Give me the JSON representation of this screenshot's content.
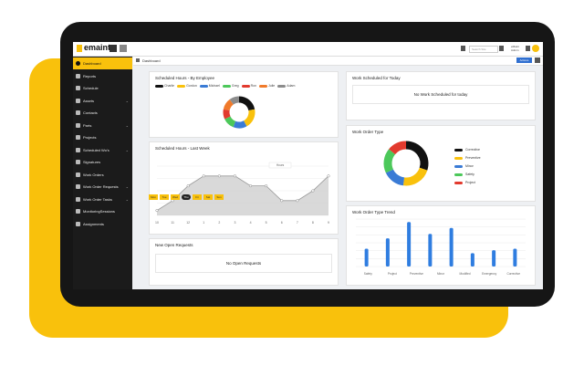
{
  "colors": {
    "accent": "#F9C10C",
    "tablet": "#161616",
    "sidebar": "#1b1b1b",
    "bar": "#2f7de0",
    "link_button": "#2f6fd0"
  },
  "topbar": {
    "logo_text": "emaint",
    "search_placeholder": "Search Site",
    "user_lines": [
      "eMaint",
      "Admin"
    ]
  },
  "sidebar": {
    "items": [
      {
        "label": "Dashboard",
        "icon": "dashboard-icon",
        "active": true,
        "caret": false
      },
      {
        "label": "Reports",
        "icon": "reports-icon",
        "caret": false
      },
      {
        "label": "Schedule",
        "icon": "calendar-icon",
        "caret": false
      },
      {
        "label": "Assets",
        "icon": "assets-icon",
        "caret": true
      },
      {
        "label": "Contacts",
        "icon": "contacts-icon",
        "caret": false
      },
      {
        "label": "Parts",
        "icon": "parts-icon",
        "caret": true
      },
      {
        "label": "Projects",
        "icon": "projects-icon",
        "caret": false
      },
      {
        "label": "Scheduled Wo's",
        "icon": "scheduled-icon",
        "caret": true
      },
      {
        "label": "Signatures",
        "icon": "signature-icon",
        "caret": false
      },
      {
        "label": "Work Orders",
        "icon": "wrench-icon",
        "caret": false
      },
      {
        "label": "Work Order Requests",
        "icon": "request-icon",
        "caret": true
      },
      {
        "label": "Work Order Tasks",
        "icon": "tasks-icon",
        "caret": true
      },
      {
        "label": "MonitoringSessions",
        "icon": "monitor-icon",
        "caret": false
      },
      {
        "label": "Assignments",
        "icon": "assignments-icon",
        "caret": false
      }
    ]
  },
  "breadcrumb": {
    "label": "Dashboard",
    "button_label": "Actions"
  },
  "scheduled_by_employee": {
    "title": "Scheduled Hours - By Employee",
    "legend": [
      {
        "name": "Charlie",
        "color": "#111111"
      },
      {
        "name": "Gordon",
        "color": "#F9C10C"
      },
      {
        "name": "Michael",
        "color": "#3a7bd5"
      },
      {
        "name": "Greg",
        "color": "#4cc85a"
      },
      {
        "name": "Ron",
        "color": "#e23a2e"
      },
      {
        "name": "Julie",
        "color": "#f07a2a"
      },
      {
        "name": "Adam",
        "color": "#8c8c8c"
      }
    ],
    "slices": [
      22,
      20,
      14,
      12,
      10,
      12,
      10
    ]
  },
  "scheduled_last_week": {
    "title": "Scheduled Hours - Last Week",
    "days": [
      {
        "label": "Mon"
      },
      {
        "label": "Tue"
      },
      {
        "label": "Wed"
      },
      {
        "label": "Thu",
        "selected": true
      },
      {
        "label": "Fri"
      },
      {
        "label": "Sat"
      },
      {
        "label": "Sun"
      }
    ],
    "tooltip": "Hours"
  },
  "chart_data": [
    {
      "type": "pie",
      "title": "Scheduled Hours - By Employee",
      "categories": [
        "Charlie",
        "Gordon",
        "Michael",
        "Greg",
        "Ron",
        "Julie",
        "Adam"
      ],
      "values": [
        22,
        20,
        14,
        12,
        10,
        12,
        10
      ]
    },
    {
      "type": "area",
      "title": "Scheduled Hours - Last Week",
      "x": [
        "10",
        "11",
        "12",
        "1",
        "2",
        "3",
        "4",
        "5",
        "6",
        "7",
        "8",
        "9"
      ],
      "values": [
        1,
        3,
        6,
        8,
        8,
        8,
        6,
        6,
        3,
        3,
        5,
        8
      ],
      "ylim": [
        0,
        10
      ]
    },
    {
      "type": "pie",
      "title": "Work Order Type",
      "categories": [
        "Corrective",
        "Preventive",
        "Minor",
        "Safety",
        "Project"
      ],
      "values": [
        30,
        22,
        16,
        18,
        14
      ]
    },
    {
      "type": "bar",
      "title": "Work Order Type Trend",
      "categories": [
        "Safety",
        "Project",
        "Preventive",
        "Minor",
        "Modified",
        "Emergency",
        "Corrective"
      ],
      "values": [
        12,
        19,
        30,
        22,
        26,
        9,
        11,
        12
      ],
      "ylim": [
        0,
        32
      ]
    }
  ],
  "new_open_requests": {
    "title": "New Open Requests",
    "empty": "No Open Requests"
  },
  "work_scheduled_today": {
    "title": "Work Scheduled for Today",
    "empty": "No Work Scheduled for today"
  },
  "work_order_type": {
    "title": "Work Order Type",
    "legend": [
      {
        "name": "Corrective",
        "color": "#111111"
      },
      {
        "name": "Preventive",
        "color": "#F9C10C"
      },
      {
        "name": "Minor",
        "color": "#3a7bd5"
      },
      {
        "name": "Safety",
        "color": "#4cc85a"
      },
      {
        "name": "Project",
        "color": "#e23a2e"
      }
    ]
  },
  "work_order_type_trend": {
    "title": "Work Order Type Trend"
  }
}
